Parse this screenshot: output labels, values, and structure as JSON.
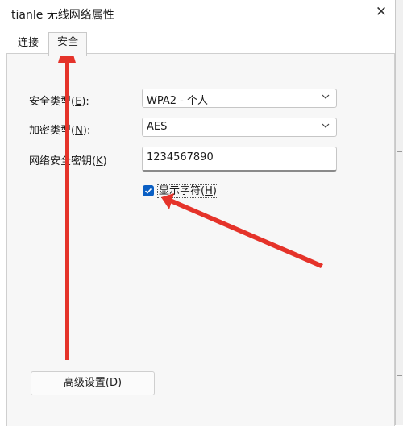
{
  "window": {
    "title": "tianle 无线网络属性",
    "close_glyph": "✕"
  },
  "tabs": [
    {
      "label": "连接",
      "selected": false
    },
    {
      "label": "安全",
      "selected": true
    }
  ],
  "security": {
    "security_type": {
      "label": "安全类型",
      "mnemonic": "E",
      "value": "WPA2 - 个人"
    },
    "encryption_type": {
      "label": "加密类型",
      "mnemonic": "N",
      "value": "AES"
    },
    "network_key": {
      "label": "网络安全密钥",
      "mnemonic": "K",
      "value": "1234567890"
    },
    "show_characters": {
      "label": "显示字符",
      "mnemonic": "H",
      "checked": true
    }
  },
  "advanced_button": {
    "label": "高级设置",
    "mnemonic": "D"
  },
  "colors": {
    "accent": "#0a5fc4",
    "annotation_arrow": "#e5332a",
    "panel_bg": "#f7f7f7"
  },
  "icons": {
    "close": "close-icon",
    "dropdown": "chevron-down-icon",
    "check": "check-icon",
    "annotation": "arrow-annotation"
  }
}
